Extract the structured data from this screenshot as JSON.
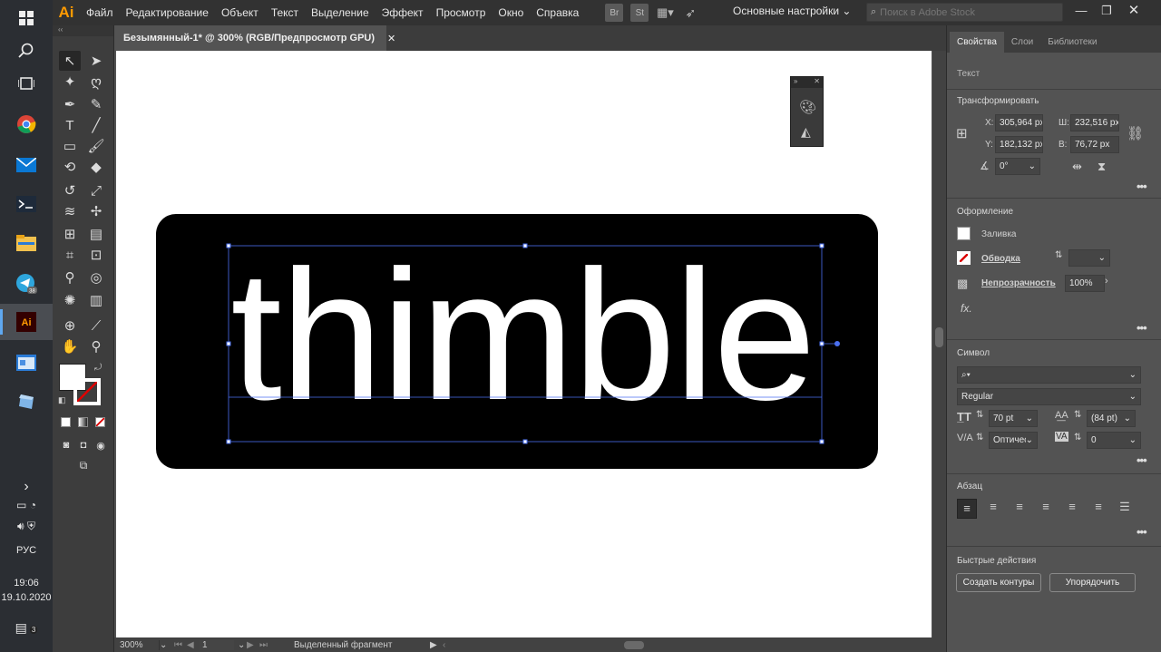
{
  "app": {
    "logo": "Ai"
  },
  "menu": [
    "Файл",
    "Редактирование",
    "Объект",
    "Текст",
    "Выделение",
    "Эффект",
    "Просмотр",
    "Окно",
    "Справка"
  ],
  "menubar_icons": {
    "br": "Br",
    "st": "St"
  },
  "workspace": "Основные настройки",
  "stock_search": {
    "placeholder": "Поиск в Adobe Stock"
  },
  "document": {
    "tab_title": "Безымянный-1* @ 300% (RGB/Предпросмотр GPU)"
  },
  "artwork": {
    "text": "thimble",
    "background": "#000000",
    "text_color": "#ffffff"
  },
  "status": {
    "zoom": "300%",
    "page": "1",
    "selection": "Выделенный фрагмент"
  },
  "taskbar": {
    "lang": "РУС",
    "time": "19:06",
    "date": "19.10.2020",
    "notif_count": "3"
  },
  "panel": {
    "tabs": [
      "Свойства",
      "Слои",
      "Библиотеки"
    ],
    "type_label": "Текст",
    "transform": {
      "title": "Трансформировать",
      "x_label": "X:",
      "x": "305,964 px",
      "y_label": "Y:",
      "y": "182,132 px",
      "w_label": "Ш:",
      "w": "232,516 px",
      "h_label": "В:",
      "h": "76,72 px",
      "angle": "0°"
    },
    "appearance": {
      "title": "Оформление",
      "fill": "Заливка",
      "stroke": "Обводка",
      "opacity_label": "Непрозрачность",
      "opacity": "100%",
      "fx": "fx."
    },
    "character": {
      "title": "Символ",
      "font_style": "Regular",
      "size": "70 pt",
      "leading": "(84 pt)",
      "kerning": "Оптичес",
      "tracking": "0"
    },
    "paragraph": {
      "title": "Абзац"
    },
    "quick_actions": {
      "title": "Быстрые действия",
      "create_outlines": "Создать контуры",
      "arrange": "Упорядочить"
    }
  }
}
